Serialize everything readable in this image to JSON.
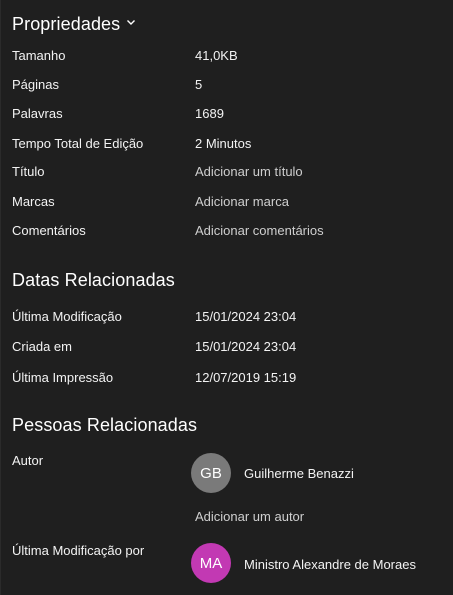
{
  "properties": {
    "title": "Propriedades",
    "rows": [
      {
        "label": "Tamanho",
        "value": "41,0KB"
      },
      {
        "label": "Páginas",
        "value": "5"
      },
      {
        "label": "Palavras",
        "value": "1689"
      },
      {
        "label": "Tempo Total de Edição",
        "value": "2 Minutos"
      },
      {
        "label": "Título",
        "value": "Adicionar um título"
      },
      {
        "label": "Marcas",
        "value": "Adicionar marca"
      },
      {
        "label": "Comentários",
        "value": "Adicionar comentários"
      }
    ]
  },
  "dates": {
    "title": "Datas Relacionadas",
    "rows": [
      {
        "label": "Última Modificação",
        "value": "15/01/2024 23:04"
      },
      {
        "label": "Criada em",
        "value": "15/01/2024 23:04"
      },
      {
        "label": "Última Impressão",
        "value": "12/07/2019 15:19"
      }
    ]
  },
  "people": {
    "title": "Pessoas Relacionadas",
    "author_label": "Autor",
    "author": {
      "initials": "GB",
      "name": "Guilherme Benazzi",
      "color": "#7a7a7a"
    },
    "add_author": "Adicionar um autor",
    "last_modified_by_label": "Última Modificação por",
    "last_modified_by": {
      "initials": "MA",
      "name": "Ministro Alexandre de Moraes",
      "color": "#c239b3"
    }
  },
  "icons": {
    "collapse": "chevron-down-icon"
  }
}
